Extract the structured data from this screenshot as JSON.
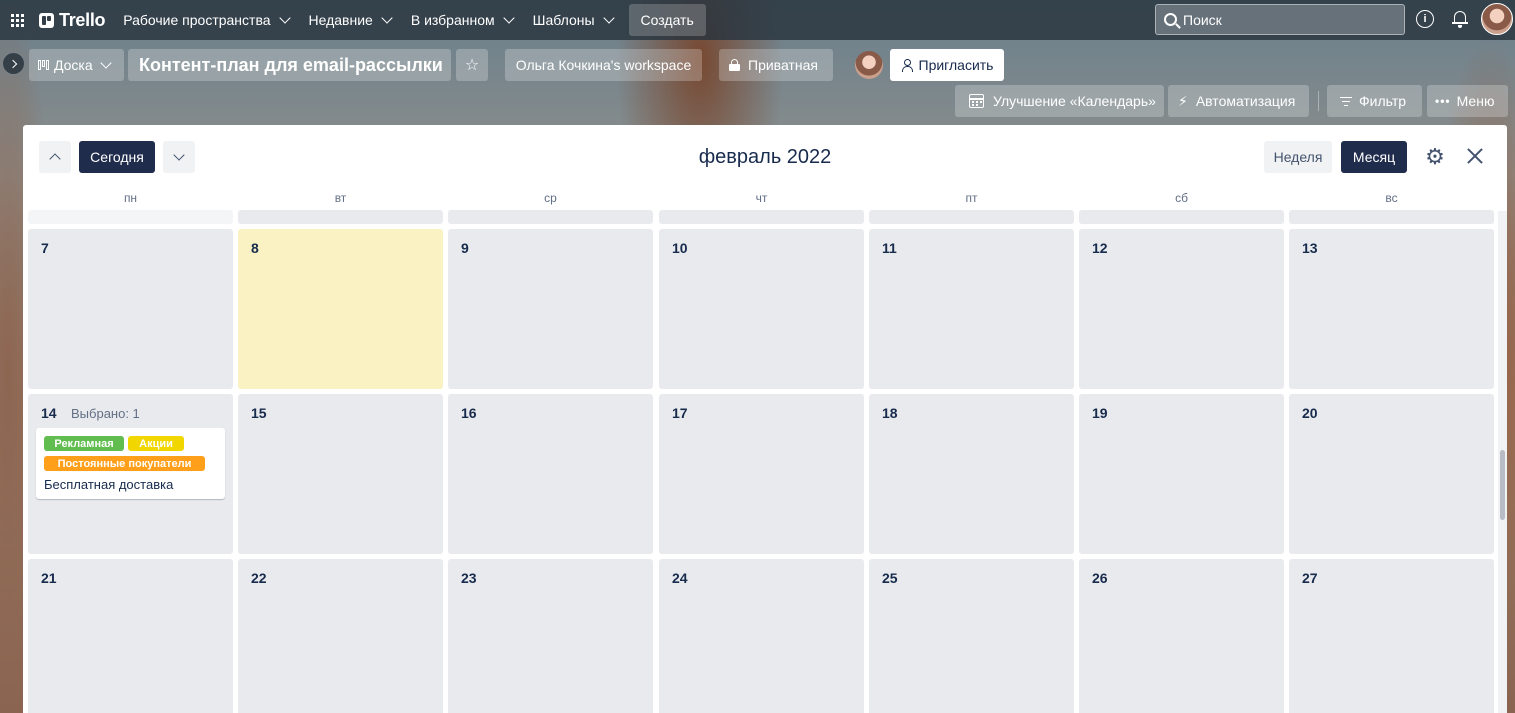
{
  "topnav": {
    "logo_text": "Trello",
    "menu": [
      {
        "label": "Рабочие пространства"
      },
      {
        "label": "Недавние"
      },
      {
        "label": "В избранном"
      },
      {
        "label": "Шаблоны"
      }
    ],
    "create_label": "Создать",
    "search_placeholder": "Поиск"
  },
  "board": {
    "view_label": "Доска",
    "title": "Контент-план для email-рассылки",
    "workspace_label": "Ольга Кочкина's workspace",
    "visibility_label": "Приватная",
    "invite_label": "Пригласить",
    "powerup_label": "Улучшение «Календарь»",
    "automation_label": "Автоматизация",
    "filter_label": "Фильтр",
    "menu_label": "Меню"
  },
  "calendar": {
    "today_label": "Сегодня",
    "title": "февраль 2022",
    "week_label": "Неделя",
    "month_label": "Месяц",
    "weekdays": [
      "пн",
      "вт",
      "ср",
      "чт",
      "пт",
      "сб",
      "вс"
    ],
    "weeks": [
      [
        "7",
        "8",
        "9",
        "10",
        "11",
        "12",
        "13"
      ],
      [
        "14",
        "15",
        "16",
        "17",
        "18",
        "19",
        "20"
      ],
      [
        "21",
        "22",
        "23",
        "24",
        "25",
        "26",
        "27"
      ]
    ],
    "today_day": "8",
    "selected_text": "Выбрано: 1",
    "card": {
      "labels": [
        {
          "text": "Рекламная",
          "color": "#61bd4f"
        },
        {
          "text": "Акции",
          "color": "#f2d600"
        },
        {
          "text": "Постоянные покупатели",
          "color": "#ff9f1a"
        }
      ],
      "title": "Бесплатная доставка"
    }
  }
}
